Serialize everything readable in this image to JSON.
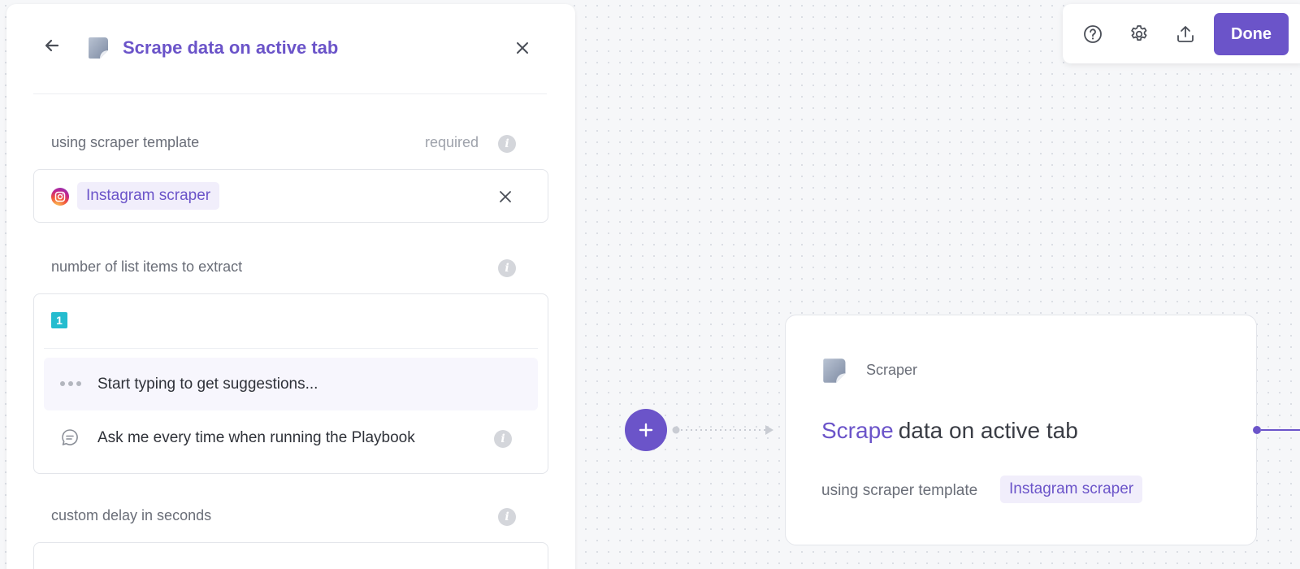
{
  "panel": {
    "title": "Scrape data on active tab",
    "back_icon": "arrow-left-icon",
    "close_icon": "close-icon",
    "template_field": {
      "label": "using scraper template",
      "required_text": "required",
      "value": "Instagram scraper",
      "value_icon": "instagram-icon"
    },
    "list_items_field": {
      "label": "number of list items to extract",
      "badge": "1",
      "suggestion_placeholder": "Start typing to get suggestions...",
      "ask_option": "Ask me every time when running the Playbook"
    },
    "delay_field": {
      "label": "custom delay in seconds"
    }
  },
  "toolbar": {
    "icons": [
      "help-icon",
      "settings-icon",
      "upload-icon"
    ],
    "done_label": "Done"
  },
  "node": {
    "type_label": "Scraper",
    "title_verb": "Scrape",
    "title_rest": "data on active tab",
    "subtitle": "using scraper template",
    "chip": "Instagram scraper"
  },
  "colors": {
    "accent": "#6b54c9",
    "chip_bg": "#f1eefb",
    "badge": "#24bccf"
  }
}
